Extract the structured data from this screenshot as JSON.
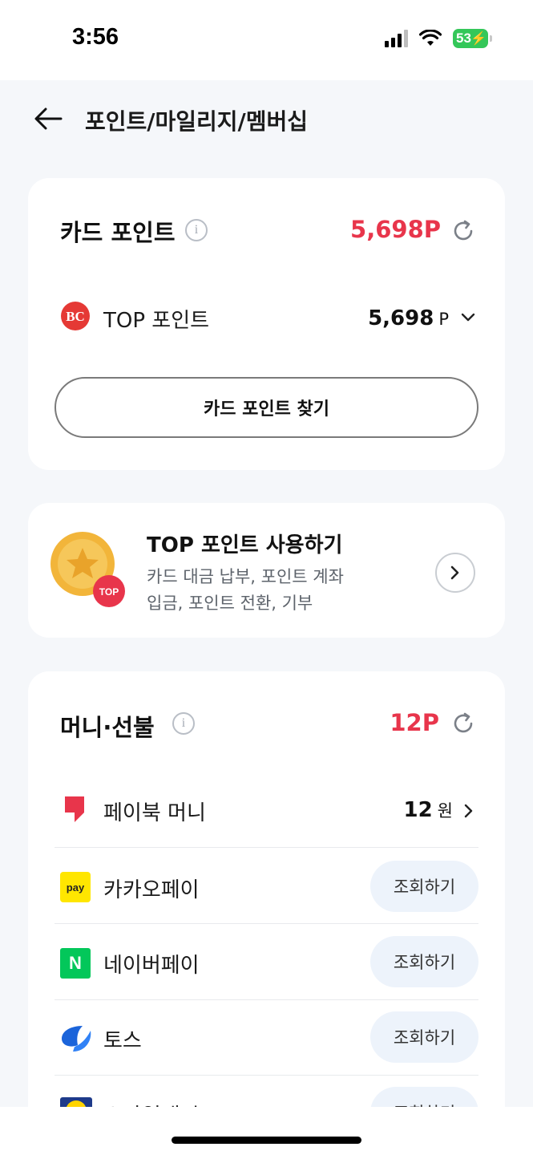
{
  "status_bar": {
    "time": "3:56",
    "battery": "53"
  },
  "header": {
    "title": "포인트/마일리지/멤버십"
  },
  "card_points": {
    "title": "카드 포인트",
    "total": "5,698P",
    "row": {
      "label": "TOP 포인트",
      "value": "5,698",
      "unit": "P"
    },
    "find_button_label": "카드 포인트 찾기"
  },
  "top_card": {
    "title": "TOP 포인트 사용하기",
    "desc_line1": "카드 대금 납부, 포인트 계좌",
    "desc_line2": "입금, 포인트 전환, 기부",
    "badge": "TOP"
  },
  "money_card": {
    "title": "머니·선불",
    "total": "12P",
    "items": [
      {
        "label": "페이북 머니",
        "value": "12",
        "unit": "원"
      },
      {
        "label": "카카오페이",
        "button": "조회하기",
        "logo_text": "pay"
      },
      {
        "label": "네이버페이",
        "button": "조회하기",
        "logo_text": "N"
      },
      {
        "label": "토스",
        "button": "조회하기"
      },
      {
        "label": "스마일캐시",
        "button": "조회하기"
      }
    ]
  }
}
